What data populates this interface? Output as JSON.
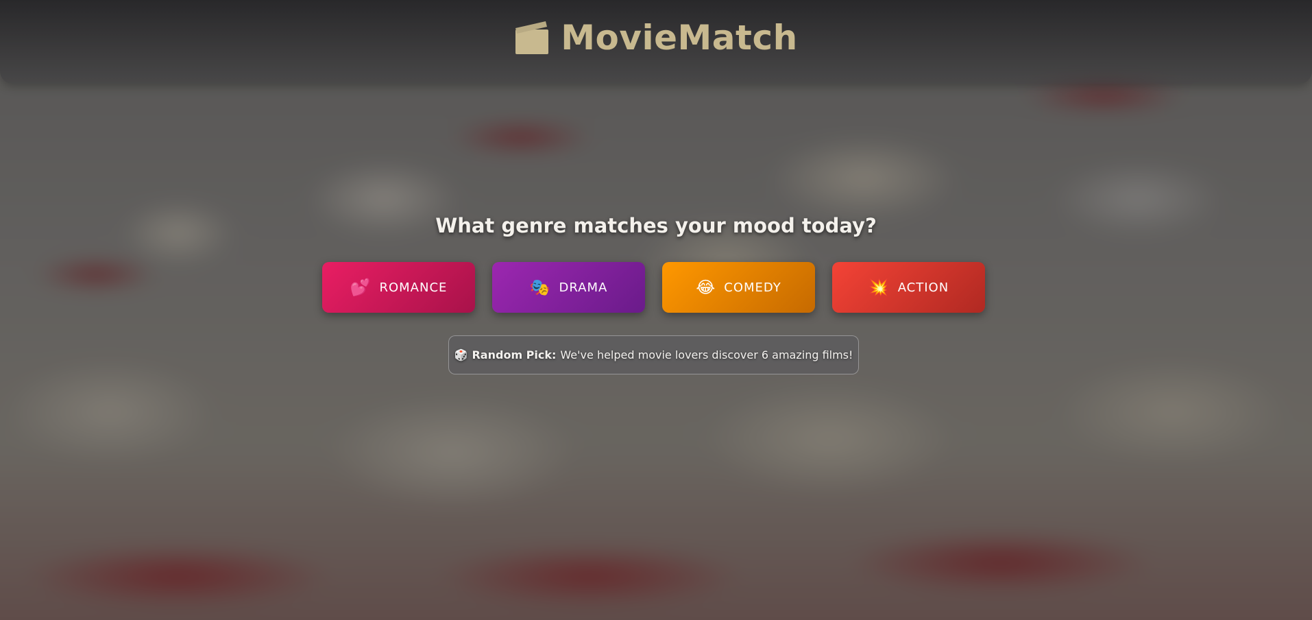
{
  "app": {
    "title": "MovieMatch"
  },
  "header": {
    "logo_icon": "clapperboard-icon"
  },
  "main": {
    "question": "What genre matches your mood today?",
    "genres": [
      {
        "label": "ROMANCE",
        "emoji": "💕",
        "icon": "two-hearts-icon",
        "color_from": "#e91e63",
        "color_to": "#a8124a"
      },
      {
        "label": "DRAMA",
        "emoji": "🎭",
        "icon": "performing-arts-icon",
        "color_from": "#9c27b0",
        "color_to": "#6a1b8a"
      },
      {
        "label": "COMEDY",
        "emoji": "😂",
        "icon": "laughing-face-icon",
        "color_from": "#ff9800",
        "color_to": "#c66a00"
      },
      {
        "label": "ACTION",
        "emoji": "💥",
        "icon": "collision-icon",
        "color_from": "#f44336",
        "color_to": "#b02922"
      }
    ],
    "random_pick": {
      "emoji": "🎲",
      "icon": "dice-icon",
      "label": "Random Pick:",
      "text": "We've helped movie lovers discover 6 amazing films!"
    }
  },
  "colors": {
    "brand": "#c8b98f"
  }
}
